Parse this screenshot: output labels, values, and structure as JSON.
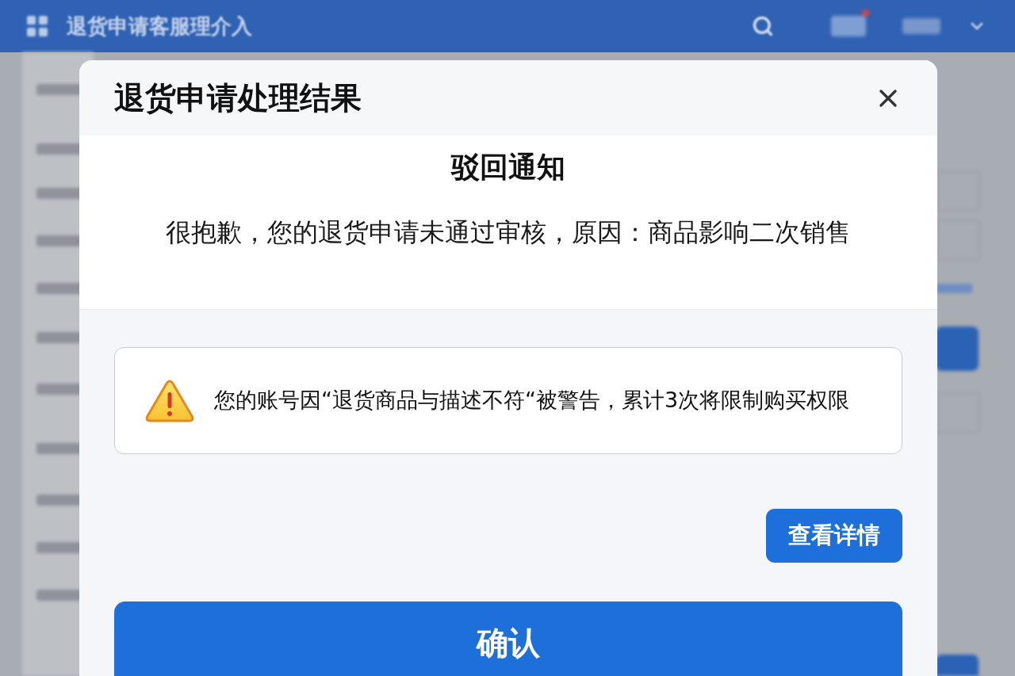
{
  "app_bar": {
    "title": "退货申请客服理介入"
  },
  "dialog": {
    "title": "退货申请处理结果",
    "notice": {
      "heading": "驳回通知",
      "message": "很抱歉，您的退货申请未通过审核，原因：商品影响二次销售"
    },
    "warning": {
      "text": "您的账号因“退货商品与描述不符“被警告，累计3次将限制购买权限"
    },
    "buttons": [
      {
        "kind": "secondary",
        "label": "查看详情"
      },
      {
        "kind": "primary",
        "label": "确认"
      }
    ]
  }
}
